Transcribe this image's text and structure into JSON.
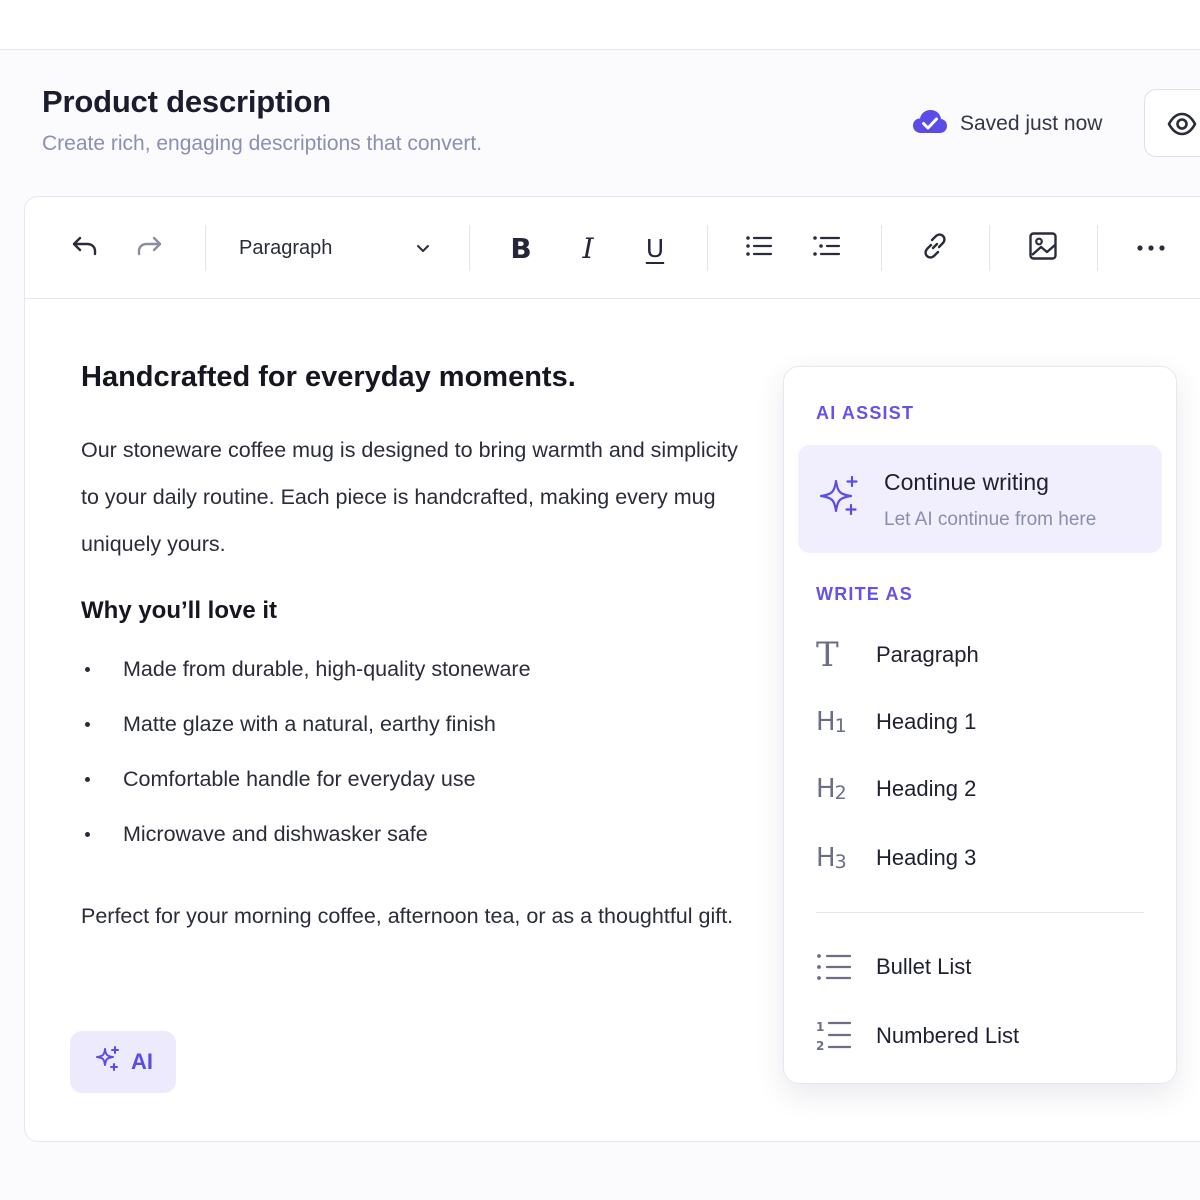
{
  "header": {
    "title": "Product description",
    "subtitle": "Create rich, engaging descriptions that convert.",
    "save_status": "Saved just now",
    "accent_color": "#5b4ce8"
  },
  "toolbar": {
    "block_type": "Paragraph",
    "bold_label": "B",
    "italic_label": "I",
    "underline_label": "U",
    "icons": [
      "undo-icon",
      "redo-icon",
      "chevron-down-icon",
      "bullet-list-icon",
      "indent-list-icon",
      "link-icon",
      "image-icon",
      "more-icon"
    ]
  },
  "document": {
    "heading": "Handcrafted for everyday moments.",
    "intro": "Our stoneware coffee mug is designed to bring warmth and simplicity to your daily routine. Each piece is handcrafted, making every mug uniquely yours.",
    "subheading": "Why you’ll love it",
    "bullets": [
      "Made from durable, high-quality stoneware",
      "Matte glaze with a natural, earthy finish",
      "Comfortable handle for everyday use",
      "Microwave and dishwasker safe"
    ],
    "closing": "Perfect for your morning coffee, afternoon tea, or as a thoughtful gift."
  },
  "ai_button": {
    "label": "AI"
  },
  "ai_panel": {
    "assist_label": "AI ASSIST",
    "continue": {
      "title": "Continue writing",
      "subtitle": "Let AI continue from here"
    },
    "write_as_label": "WRITE AS",
    "write_as": [
      {
        "icon": "T",
        "label": "Paragraph"
      },
      {
        "icon": "H1",
        "label": "Heading 1"
      },
      {
        "icon": "H2",
        "label": "Heading 2"
      },
      {
        "icon": "H3",
        "label": "Heading 3"
      }
    ],
    "lists": [
      {
        "icon": "bullet-list-icon",
        "label": "Bullet List"
      },
      {
        "icon": "numbered-list-icon",
        "label": "Numbered List"
      }
    ],
    "h1_glyph": "H",
    "h1_num": "1",
    "h2_glyph": "H",
    "h2_num": "2",
    "h3_glyph": "H",
    "h3_num": "3",
    "t_glyph": "T"
  }
}
